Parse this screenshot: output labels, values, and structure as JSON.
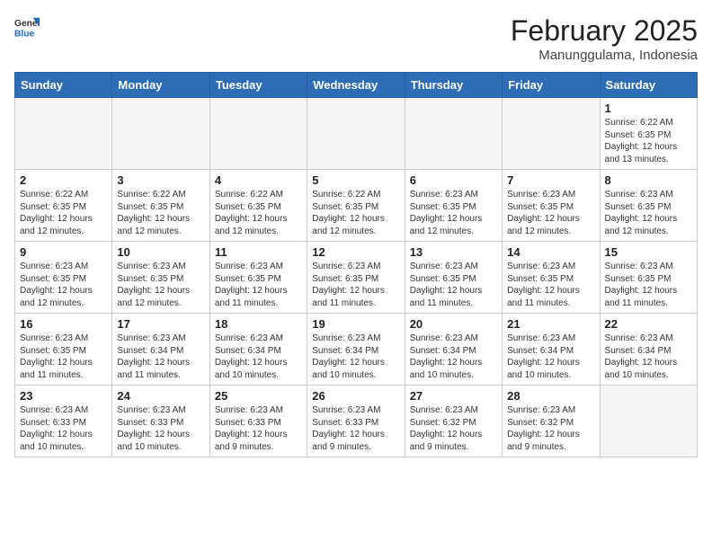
{
  "header": {
    "logo_general": "General",
    "logo_blue": "Blue",
    "month_year": "February 2025",
    "location": "Manunggulama, Indonesia"
  },
  "weekdays": [
    "Sunday",
    "Monday",
    "Tuesday",
    "Wednesday",
    "Thursday",
    "Friday",
    "Saturday"
  ],
  "weeks": [
    [
      {
        "day": "",
        "info": ""
      },
      {
        "day": "",
        "info": ""
      },
      {
        "day": "",
        "info": ""
      },
      {
        "day": "",
        "info": ""
      },
      {
        "day": "",
        "info": ""
      },
      {
        "day": "",
        "info": ""
      },
      {
        "day": "1",
        "info": "Sunrise: 6:22 AM\nSunset: 6:35 PM\nDaylight: 12 hours\nand 13 minutes."
      }
    ],
    [
      {
        "day": "2",
        "info": "Sunrise: 6:22 AM\nSunset: 6:35 PM\nDaylight: 12 hours\nand 12 minutes."
      },
      {
        "day": "3",
        "info": "Sunrise: 6:22 AM\nSunset: 6:35 PM\nDaylight: 12 hours\nand 12 minutes."
      },
      {
        "day": "4",
        "info": "Sunrise: 6:22 AM\nSunset: 6:35 PM\nDaylight: 12 hours\nand 12 minutes."
      },
      {
        "day": "5",
        "info": "Sunrise: 6:22 AM\nSunset: 6:35 PM\nDaylight: 12 hours\nand 12 minutes."
      },
      {
        "day": "6",
        "info": "Sunrise: 6:23 AM\nSunset: 6:35 PM\nDaylight: 12 hours\nand 12 minutes."
      },
      {
        "day": "7",
        "info": "Sunrise: 6:23 AM\nSunset: 6:35 PM\nDaylight: 12 hours\nand 12 minutes."
      },
      {
        "day": "8",
        "info": "Sunrise: 6:23 AM\nSunset: 6:35 PM\nDaylight: 12 hours\nand 12 minutes."
      }
    ],
    [
      {
        "day": "9",
        "info": "Sunrise: 6:23 AM\nSunset: 6:35 PM\nDaylight: 12 hours\nand 12 minutes."
      },
      {
        "day": "10",
        "info": "Sunrise: 6:23 AM\nSunset: 6:35 PM\nDaylight: 12 hours\nand 12 minutes."
      },
      {
        "day": "11",
        "info": "Sunrise: 6:23 AM\nSunset: 6:35 PM\nDaylight: 12 hours\nand 11 minutes."
      },
      {
        "day": "12",
        "info": "Sunrise: 6:23 AM\nSunset: 6:35 PM\nDaylight: 12 hours\nand 11 minutes."
      },
      {
        "day": "13",
        "info": "Sunrise: 6:23 AM\nSunset: 6:35 PM\nDaylight: 12 hours\nand 11 minutes."
      },
      {
        "day": "14",
        "info": "Sunrise: 6:23 AM\nSunset: 6:35 PM\nDaylight: 12 hours\nand 11 minutes."
      },
      {
        "day": "15",
        "info": "Sunrise: 6:23 AM\nSunset: 6:35 PM\nDaylight: 12 hours\nand 11 minutes."
      }
    ],
    [
      {
        "day": "16",
        "info": "Sunrise: 6:23 AM\nSunset: 6:35 PM\nDaylight: 12 hours\nand 11 minutes."
      },
      {
        "day": "17",
        "info": "Sunrise: 6:23 AM\nSunset: 6:34 PM\nDaylight: 12 hours\nand 11 minutes."
      },
      {
        "day": "18",
        "info": "Sunrise: 6:23 AM\nSunset: 6:34 PM\nDaylight: 12 hours\nand 10 minutes."
      },
      {
        "day": "19",
        "info": "Sunrise: 6:23 AM\nSunset: 6:34 PM\nDaylight: 12 hours\nand 10 minutes."
      },
      {
        "day": "20",
        "info": "Sunrise: 6:23 AM\nSunset: 6:34 PM\nDaylight: 12 hours\nand 10 minutes."
      },
      {
        "day": "21",
        "info": "Sunrise: 6:23 AM\nSunset: 6:34 PM\nDaylight: 12 hours\nand 10 minutes."
      },
      {
        "day": "22",
        "info": "Sunrise: 6:23 AM\nSunset: 6:34 PM\nDaylight: 12 hours\nand 10 minutes."
      }
    ],
    [
      {
        "day": "23",
        "info": "Sunrise: 6:23 AM\nSunset: 6:33 PM\nDaylight: 12 hours\nand 10 minutes."
      },
      {
        "day": "24",
        "info": "Sunrise: 6:23 AM\nSunset: 6:33 PM\nDaylight: 12 hours\nand 10 minutes."
      },
      {
        "day": "25",
        "info": "Sunrise: 6:23 AM\nSunset: 6:33 PM\nDaylight: 12 hours\nand 9 minutes."
      },
      {
        "day": "26",
        "info": "Sunrise: 6:23 AM\nSunset: 6:33 PM\nDaylight: 12 hours\nand 9 minutes."
      },
      {
        "day": "27",
        "info": "Sunrise: 6:23 AM\nSunset: 6:32 PM\nDaylight: 12 hours\nand 9 minutes."
      },
      {
        "day": "28",
        "info": "Sunrise: 6:23 AM\nSunset: 6:32 PM\nDaylight: 12 hours\nand 9 minutes."
      },
      {
        "day": "",
        "info": ""
      }
    ]
  ]
}
